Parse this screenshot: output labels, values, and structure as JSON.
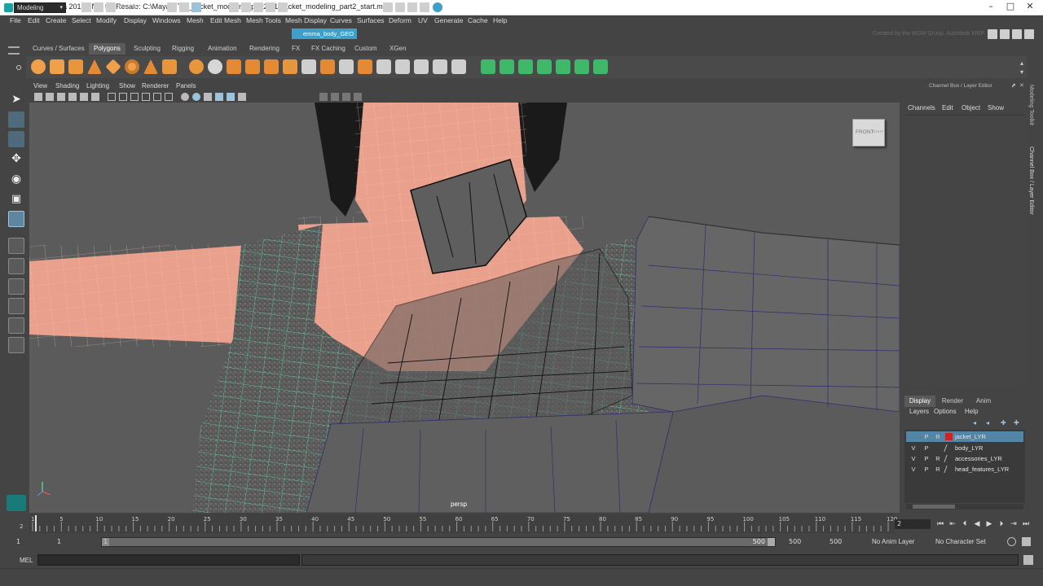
{
  "window": {
    "title": "Autodesk Maya 2016 - Not for Resale: C:\\Maya\\HTM_Jacket_modeling_part2\\01-Jacket_modeling_part2_start.mb*",
    "controls": {
      "minimize": "–",
      "maximize": "□",
      "close": "✕"
    }
  },
  "menubar": {
    "items": [
      "File",
      "Edit",
      "Create",
      "Select",
      "Modify",
      "Display",
      "Windows",
      "Mesh",
      "Edit Mesh",
      "Mesh Tools",
      "Mesh Display",
      "Curves",
      "Surfaces",
      "Deform",
      "UV",
      "Generate",
      "Cache",
      "Help"
    ]
  },
  "statusline": {
    "mode": "Modeling",
    "object_field": "emma_body_GEO",
    "created_by": "Created by the WDM Group, Autodesk MRP"
  },
  "shelf": {
    "tabs": [
      "Curves / Surfaces",
      "Polygons",
      "Sculpting",
      "Rigging",
      "Animation",
      "Rendering",
      "FX",
      "FX Caching",
      "Custom",
      "XGen"
    ],
    "active_tab": "Polygons"
  },
  "viewport": {
    "menus": [
      "View",
      "Shading",
      "Lighting",
      "Show",
      "Renderer",
      "Panels"
    ],
    "camera_label": "persp",
    "viewcube_label": "FRONT",
    "viewcube_side": "RIGHT"
  },
  "channel_box": {
    "header": "Channel Box / Layer Editor",
    "menus": [
      "Channels",
      "Edit",
      "Object",
      "Show"
    ]
  },
  "layer_editor": {
    "tabs": [
      "Display",
      "Render",
      "Anim"
    ],
    "active_tab": "Display",
    "menus": [
      "Layers",
      "Options",
      "Help"
    ],
    "layers": [
      {
        "v": "",
        "p": "P",
        "r": "R",
        "name": "jacket_LYR",
        "color": "#d21f1f",
        "selected": true
      },
      {
        "v": "V",
        "p": "P",
        "r": "",
        "name": "body_LYR",
        "color": "",
        "selected": false
      },
      {
        "v": "V",
        "p": "P",
        "r": "R",
        "name": "accessories_LYR",
        "color": "",
        "selected": false
      },
      {
        "v": "V",
        "p": "P",
        "r": "R",
        "name": "head_features_LYR",
        "color": "",
        "selected": false
      }
    ]
  },
  "side_tabs": {
    "modeling_toolkit": "Modeling Toolkit",
    "channel_box_layer": "Channel Box / Layer Editor"
  },
  "time_slider": {
    "ticks": [
      "1",
      "5",
      "10",
      "15",
      "20",
      "25",
      "30",
      "35",
      "40",
      "45",
      "50",
      "55",
      "60",
      "65",
      "70",
      "75",
      "80",
      "85",
      "90",
      "95",
      "100",
      "105",
      "110",
      "115",
      "120"
    ],
    "current_frame": "2",
    "current_field": "2"
  },
  "range_slider": {
    "start": "1",
    "inner_start": "1",
    "slider_value": "1",
    "inner_end": "500",
    "end": "500",
    "outer_end": "500",
    "anim_layer": "No Anim Layer",
    "character_set": "No Character Set"
  },
  "command_line": {
    "label": "MEL"
  },
  "colors": {
    "ui_bg": "#444444",
    "viewport_bg": "#5b5b5b",
    "accent": "#3ea0c8",
    "wire_green": "#5dffb0",
    "skin": "#e9a08c",
    "layer_selected": "#5285a6"
  }
}
